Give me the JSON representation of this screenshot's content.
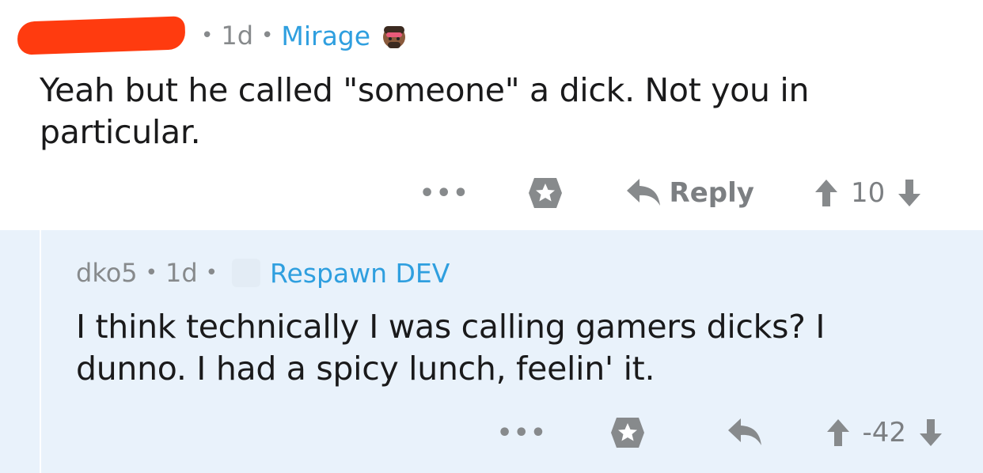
{
  "comments": [
    {
      "age": "1d",
      "flair": "Mirage",
      "flair_icon": "avatar-head-icon",
      "body": "Yeah but he called \"someone\" a dick. Not you in particular.",
      "actions": {
        "more": "•••",
        "reply_label": "Reply",
        "score": "10"
      }
    },
    {
      "author": "dko5",
      "age": "1d",
      "flair": "Respawn DEV",
      "body": "I think technically I was calling gamers dicks? I dunno. I had a spicy lunch, feelin' it.",
      "actions": {
        "more": "•••",
        "score": "-42"
      }
    }
  ],
  "colors": {
    "flair": "#2f9fdf",
    "redaction": "#ff3b0f",
    "highlight_bg": "#e9f2fb",
    "meta": "#878a8c"
  }
}
